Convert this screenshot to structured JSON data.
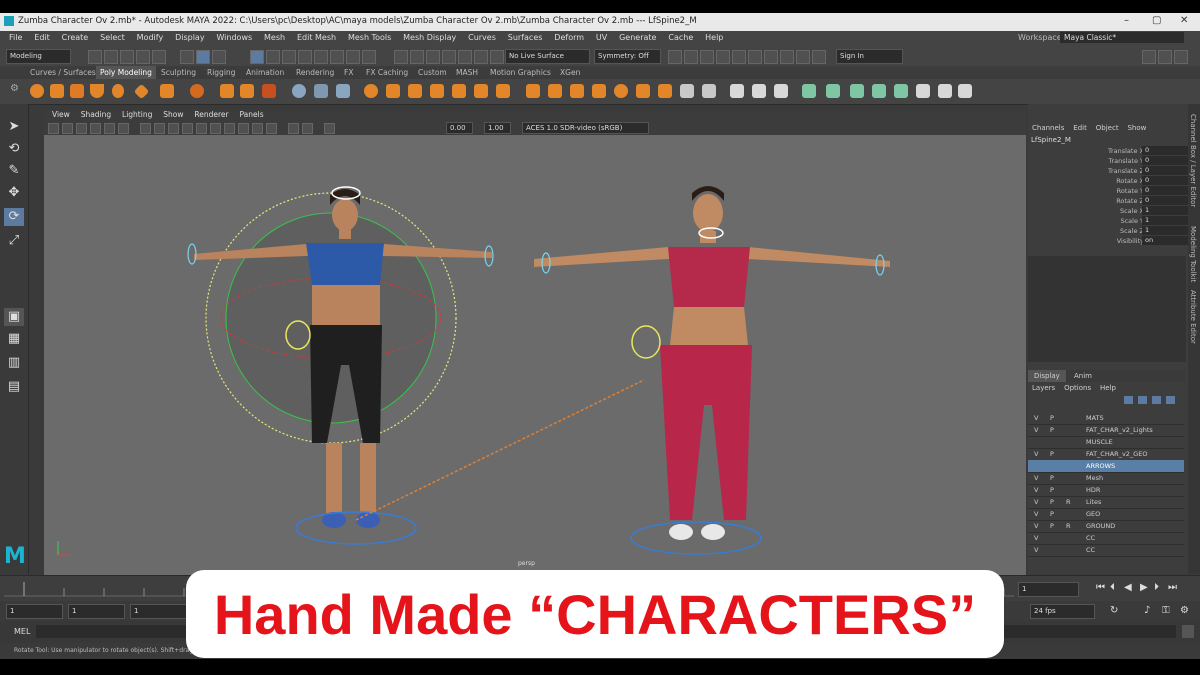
{
  "title_bar": {
    "text": "Zumba Character Ov 2.mb* - Autodesk MAYA 2022: C:\\Users\\pc\\Desktop\\AC\\maya models\\Zumba Character Ov 2.mb\\Zumba Character Ov 2.mb  ---  LfSpine2_M"
  },
  "menubar": {
    "items": [
      "File",
      "Edit",
      "Create",
      "Select",
      "Modify",
      "Display",
      "Windows",
      "Mesh",
      "Edit Mesh",
      "Mesh Tools",
      "Mesh Display",
      "Curves",
      "Surfaces",
      "Deform",
      "UV",
      "Generate",
      "Cache",
      "Help"
    ],
    "workspace_label": "Workspace :",
    "workspace_value": "Maya Classic*"
  },
  "status_line": {
    "mode": "Modeling",
    "live_surface": "No Live Surface",
    "symmetry": "Symmetry: Off",
    "sign_in": "Sign In"
  },
  "shelf_tabs": {
    "items": [
      "Curves / Surfaces",
      "Poly Modeling",
      "Sculpting",
      "Rigging",
      "Animation",
      "Rendering",
      "FX",
      "FX Caching",
      "Custom",
      "MASH",
      "Motion Graphics",
      "XGen"
    ],
    "active": "Poly Modeling"
  },
  "panel_menu": {
    "items": [
      "View",
      "Shading",
      "Lighting",
      "Show",
      "Renderer",
      "Panels"
    ]
  },
  "panel_toolbar": {
    "value_a": "0.00",
    "value_b": "1.00",
    "color_space": "ACES 1.0 SDR-video (sRGB)"
  },
  "viewport": {
    "camera_label": "persp"
  },
  "channel_box": {
    "menus": [
      "Channels",
      "Edit",
      "Object",
      "Show"
    ],
    "object": "LfSpine2_M",
    "attributes": [
      {
        "name": "Translate X",
        "value": "0"
      },
      {
        "name": "Translate Y",
        "value": "0"
      },
      {
        "name": "Translate Z",
        "value": "0"
      },
      {
        "name": "Rotate X",
        "value": "0"
      },
      {
        "name": "Rotate Y",
        "value": "0"
      },
      {
        "name": "Rotate Z",
        "value": "0"
      },
      {
        "name": "Scale X",
        "value": "1"
      },
      {
        "name": "Scale Y",
        "value": "1"
      },
      {
        "name": "Scale Z",
        "value": "1"
      },
      {
        "name": "Visibility",
        "value": "on"
      }
    ]
  },
  "layer_editor": {
    "tabs": [
      "Display",
      "Anim"
    ],
    "menus": [
      "Layers",
      "Options",
      "Help"
    ],
    "layers": [
      {
        "v": "V",
        "p": "P",
        "r": "",
        "name": "MATS"
      },
      {
        "v": "V",
        "p": "P",
        "r": "",
        "name": "FAT_CHAR_v2_Lights"
      },
      {
        "v": "",
        "p": "",
        "r": "",
        "name": "MUSCLE"
      },
      {
        "v": "V",
        "p": "P",
        "r": "",
        "name": "FAT_CHAR_v2_GEO"
      },
      {
        "v": "",
        "p": "",
        "r": "",
        "name": "ARROWS"
      },
      {
        "v": "V",
        "p": "P",
        "r": "",
        "name": "Mesh"
      },
      {
        "v": "V",
        "p": "P",
        "r": "",
        "name": "HDR"
      },
      {
        "v": "V",
        "p": "P",
        "r": "R",
        "name": "Lites"
      },
      {
        "v": "V",
        "p": "P",
        "r": "",
        "name": "GEO"
      },
      {
        "v": "V",
        "p": "P",
        "r": "R",
        "name": "GROUND"
      },
      {
        "v": "V",
        "p": "",
        "r": "",
        "name": "CC"
      },
      {
        "v": "V",
        "p": "",
        "r": "",
        "name": "CC"
      }
    ],
    "selected_layer": "ARROWS"
  },
  "side_tabs": [
    "Channel Box / Layer Editor",
    "Modeling Toolkit",
    "Attribute Editor"
  ],
  "timeline": {
    "current_frame": "1",
    "range_start": "1",
    "range_start_b": "1",
    "range_end_field": "1",
    "fps": "24 fps"
  },
  "command_line": {
    "label": "MEL"
  },
  "help_line": {
    "text": "Rotate Tool: Use manipulator to rotate object(s). Shift+drag manipulator..."
  },
  "banner": {
    "text": "Hand Made “CHARACTERS”"
  },
  "colors": {
    "maya_ui": "#444444",
    "viewport": "#6b6b6b",
    "banner_text": "#e5141b",
    "selection": "#5a7fa6"
  }
}
